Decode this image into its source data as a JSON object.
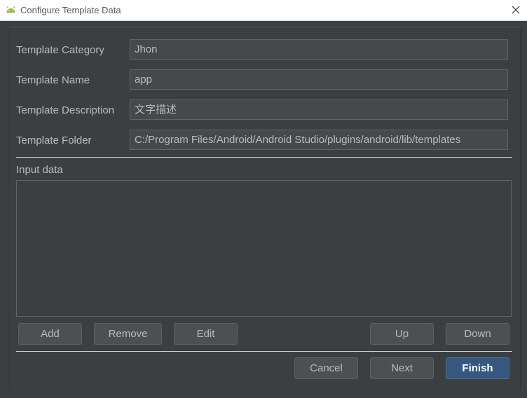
{
  "window": {
    "title": "Configure Template Data",
    "close_icon": "close-icon",
    "app_icon": "android-icon"
  },
  "form": {
    "fields": [
      {
        "label": "Template Category",
        "value": "Jhon"
      },
      {
        "label": "Template Name",
        "value": "app"
      },
      {
        "label": "Template Description",
        "value": "文字描述"
      },
      {
        "label": "Template Folder",
        "value": "C:/Program Files/Android/Android Studio/plugins/android/lib/templates"
      }
    ]
  },
  "input_data": {
    "label": "Input data"
  },
  "table_buttons": {
    "add": "Add",
    "remove": "Remove",
    "edit": "Edit",
    "up": "Up",
    "down": "Down"
  },
  "dialog_buttons": {
    "cancel": "Cancel",
    "next": "Next",
    "finish": "Finish"
  },
  "colors": {
    "background": "#3c3f41",
    "primary_button": "#365880",
    "text": "#bbbbbb"
  }
}
